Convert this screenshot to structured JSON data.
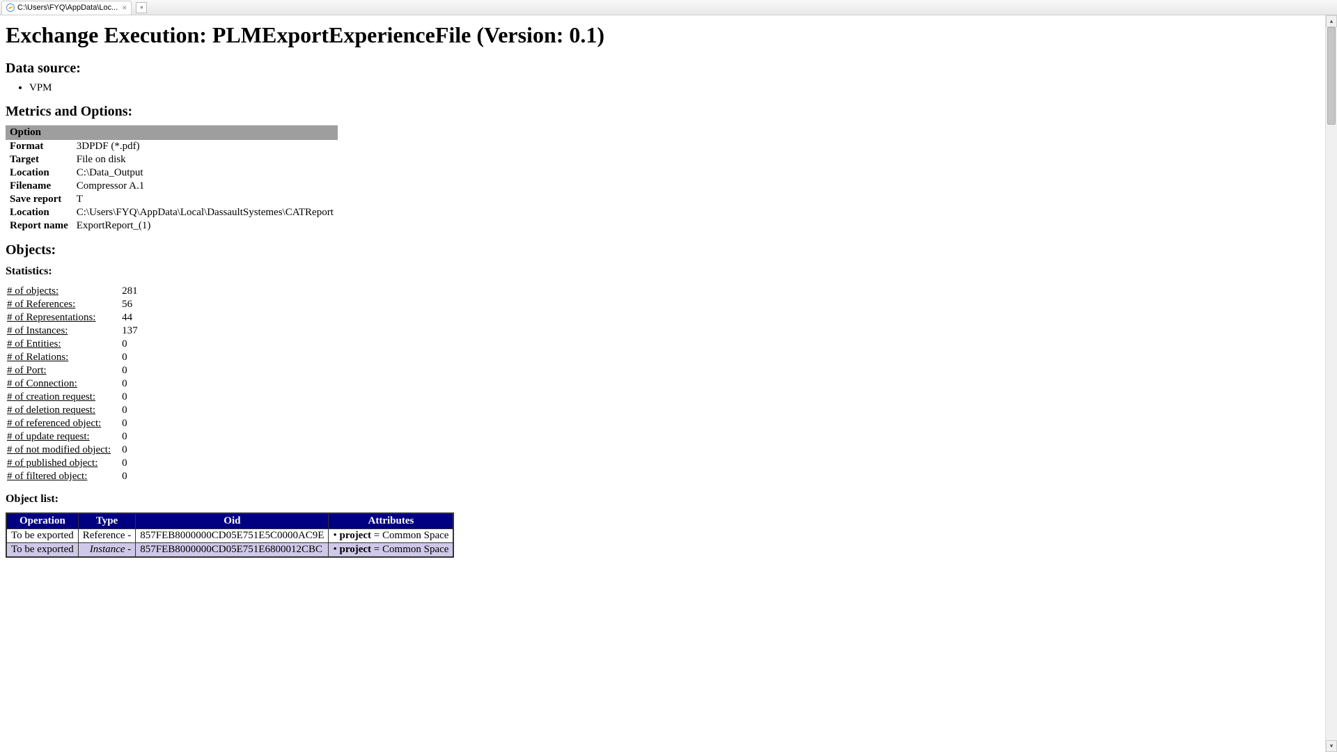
{
  "browser": {
    "tab_title": "C:\\Users\\FYQ\\AppData\\Loc...",
    "tab_close": "×",
    "new_tab_icon": "▫"
  },
  "page": {
    "title": "Exchange Execution: PLMExportExperienceFile (Version: 0.1)",
    "data_source_heading": "Data source:",
    "data_sources": [
      "VPM"
    ],
    "metrics_heading": "Metrics and Options:",
    "options_header": "Option",
    "options": [
      {
        "label": "Format",
        "value": "3DPDF (*.pdf)"
      },
      {
        "label": "Target",
        "value": "File on disk"
      },
      {
        "label": "Location",
        "value": "C:\\Data_Output"
      },
      {
        "label": "Filename",
        "value": "Compressor A.1"
      },
      {
        "label": "Save report",
        "value": "T"
      },
      {
        "label": "Location",
        "value": "C:\\Users\\FYQ\\AppData\\Local\\DassaultSystemes\\CATReport"
      },
      {
        "label": "Report name",
        "value": "ExportReport_(1)"
      }
    ],
    "objects_heading": "Objects:",
    "statistics_heading": "Statistics:",
    "statistics": [
      {
        "label": "# of objects:",
        "value": "281"
      },
      {
        "label": "# of References:",
        "value": "56"
      },
      {
        "label": "# of Representations:",
        "value": "44"
      },
      {
        "label": "# of Instances:",
        "value": "137"
      },
      {
        "label": "# of Entities:",
        "value": "0"
      },
      {
        "label": "# of Relations:",
        "value": "0"
      },
      {
        "label": "# of Port:",
        "value": "0"
      },
      {
        "label": "# of Connection:",
        "value": "0"
      },
      {
        "label": "# of creation request:",
        "value": "0"
      },
      {
        "label": "# of deletion request:",
        "value": "0"
      },
      {
        "label": "# of referenced object:",
        "value": "0"
      },
      {
        "label": "# of update request:",
        "value": "0"
      },
      {
        "label": "# of not modified object:",
        "value": "0"
      },
      {
        "label": "# of published object:",
        "value": "0"
      },
      {
        "label": "# of filtered object:",
        "value": "0"
      }
    ],
    "object_list_heading": "Object list:",
    "object_list_headers": {
      "operation": "Operation",
      "type": "Type",
      "oid": "Oid",
      "attributes": "Attributes"
    },
    "object_list": [
      {
        "operation": "To be exported",
        "type": "Reference -",
        "type_italic": false,
        "oid": "857FEB8000000CD05E751E5C0000AC9E",
        "attr_key": "project",
        "attr_val": "Common Space"
      },
      {
        "operation": "To be exported",
        "type": "Instance -",
        "type_italic": true,
        "oid": "857FEB8000000CD05E751E6800012CBC",
        "attr_key": "project",
        "attr_val": "Common Space"
      }
    ]
  },
  "scroll": {
    "up": "▴",
    "down": "▾"
  }
}
